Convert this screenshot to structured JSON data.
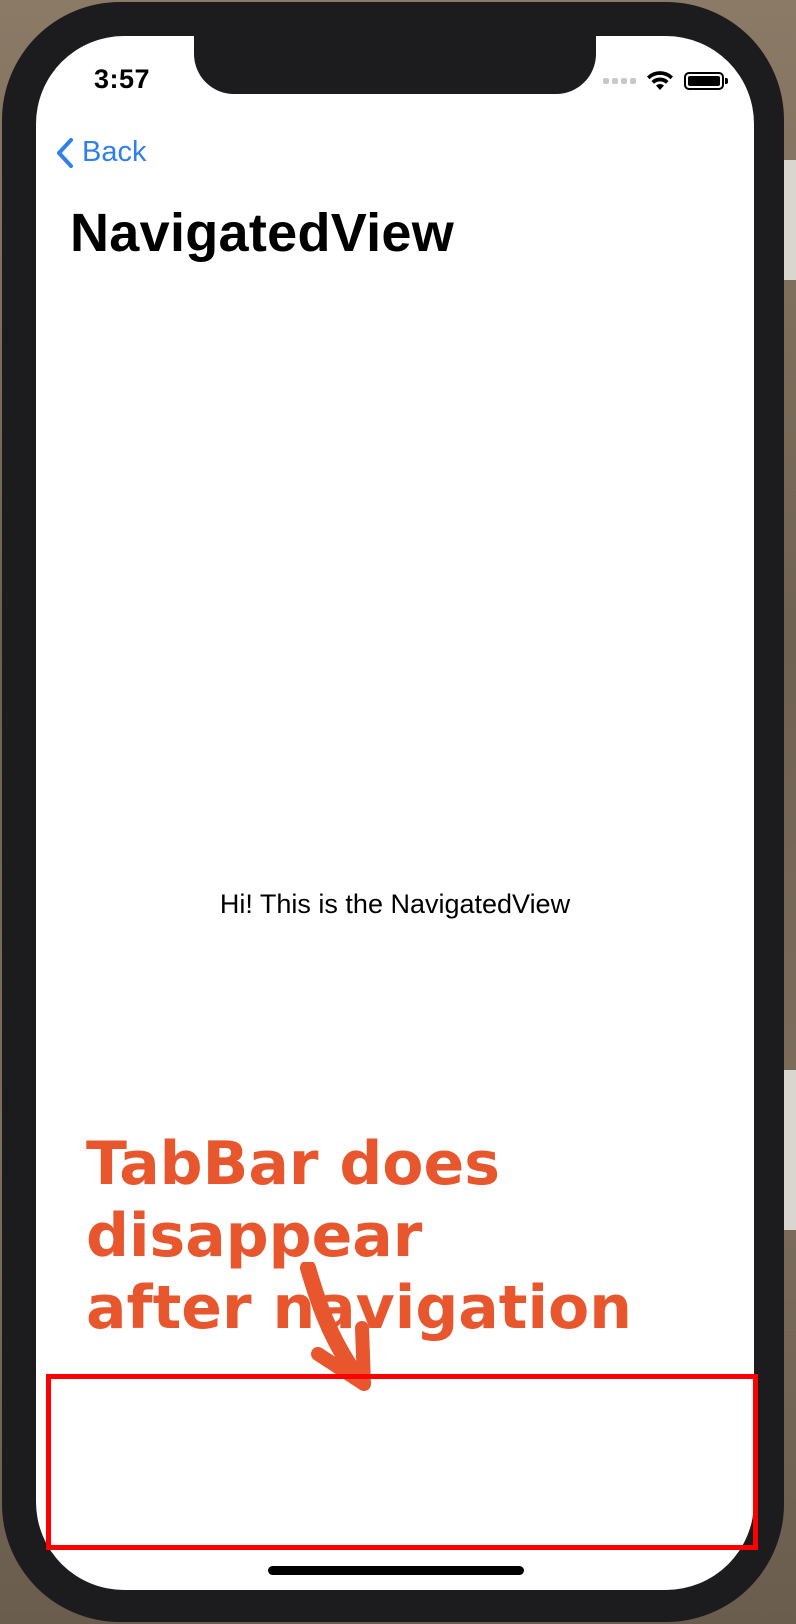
{
  "status_bar": {
    "time": "3:57"
  },
  "navigation": {
    "back_label": "Back",
    "title": "NavigatedView"
  },
  "content": {
    "message": "Hi! This is the NavigatedView"
  },
  "annotation": {
    "line1": "TabBar does disappear",
    "line2": "after navigation",
    "color": "#e8562e",
    "box_color": "#ff0000"
  },
  "icons": {
    "back": "chevron-left-icon",
    "wifi": "wifi-icon",
    "signal": "cellular-signal-icon",
    "battery": "battery-icon"
  },
  "colors": {
    "accent": "#2f80ed"
  }
}
